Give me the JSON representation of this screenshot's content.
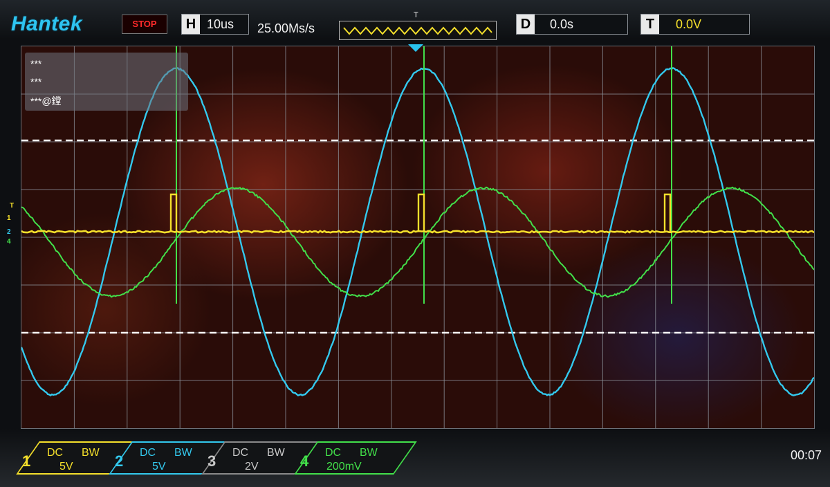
{
  "header": {
    "brand": "Hantek",
    "run_state": "STOP",
    "h_key": "H",
    "h_value": "10us",
    "sample_rate": "25.00Ms/s",
    "trig_marker": "T",
    "d_key": "D",
    "d_value": "0.0s",
    "t_key": "T",
    "t_value": "0.0V"
  },
  "popup": {
    "items": [
      "***",
      "***",
      "***@鏜"
    ]
  },
  "markers": {
    "ch1": "1",
    "ch2": "2",
    "ch4": "4",
    "trig": "T"
  },
  "channels": [
    {
      "num": "1",
      "coupling": "DC",
      "bw": "BW",
      "scale": "5V",
      "color": "#f5e02b"
    },
    {
      "num": "2",
      "coupling": "DC",
      "bw": "BW",
      "scale": "5V",
      "color": "#33c9ee"
    },
    {
      "num": "3",
      "coupling": "DC",
      "bw": "BW",
      "scale": "2V",
      "color": "#c8c8c8"
    },
    {
      "num": "4",
      "coupling": "DC",
      "bw": "BW",
      "scale": "200mV",
      "color": "#42e04a"
    }
  ],
  "clock": "00:07",
  "colors": {
    "ch1": "#f5e02b",
    "ch2": "#33c9ee",
    "ch4": "#42e04a",
    "brand": "#2ec4f0",
    "stop": "#ff2a2a"
  }
}
